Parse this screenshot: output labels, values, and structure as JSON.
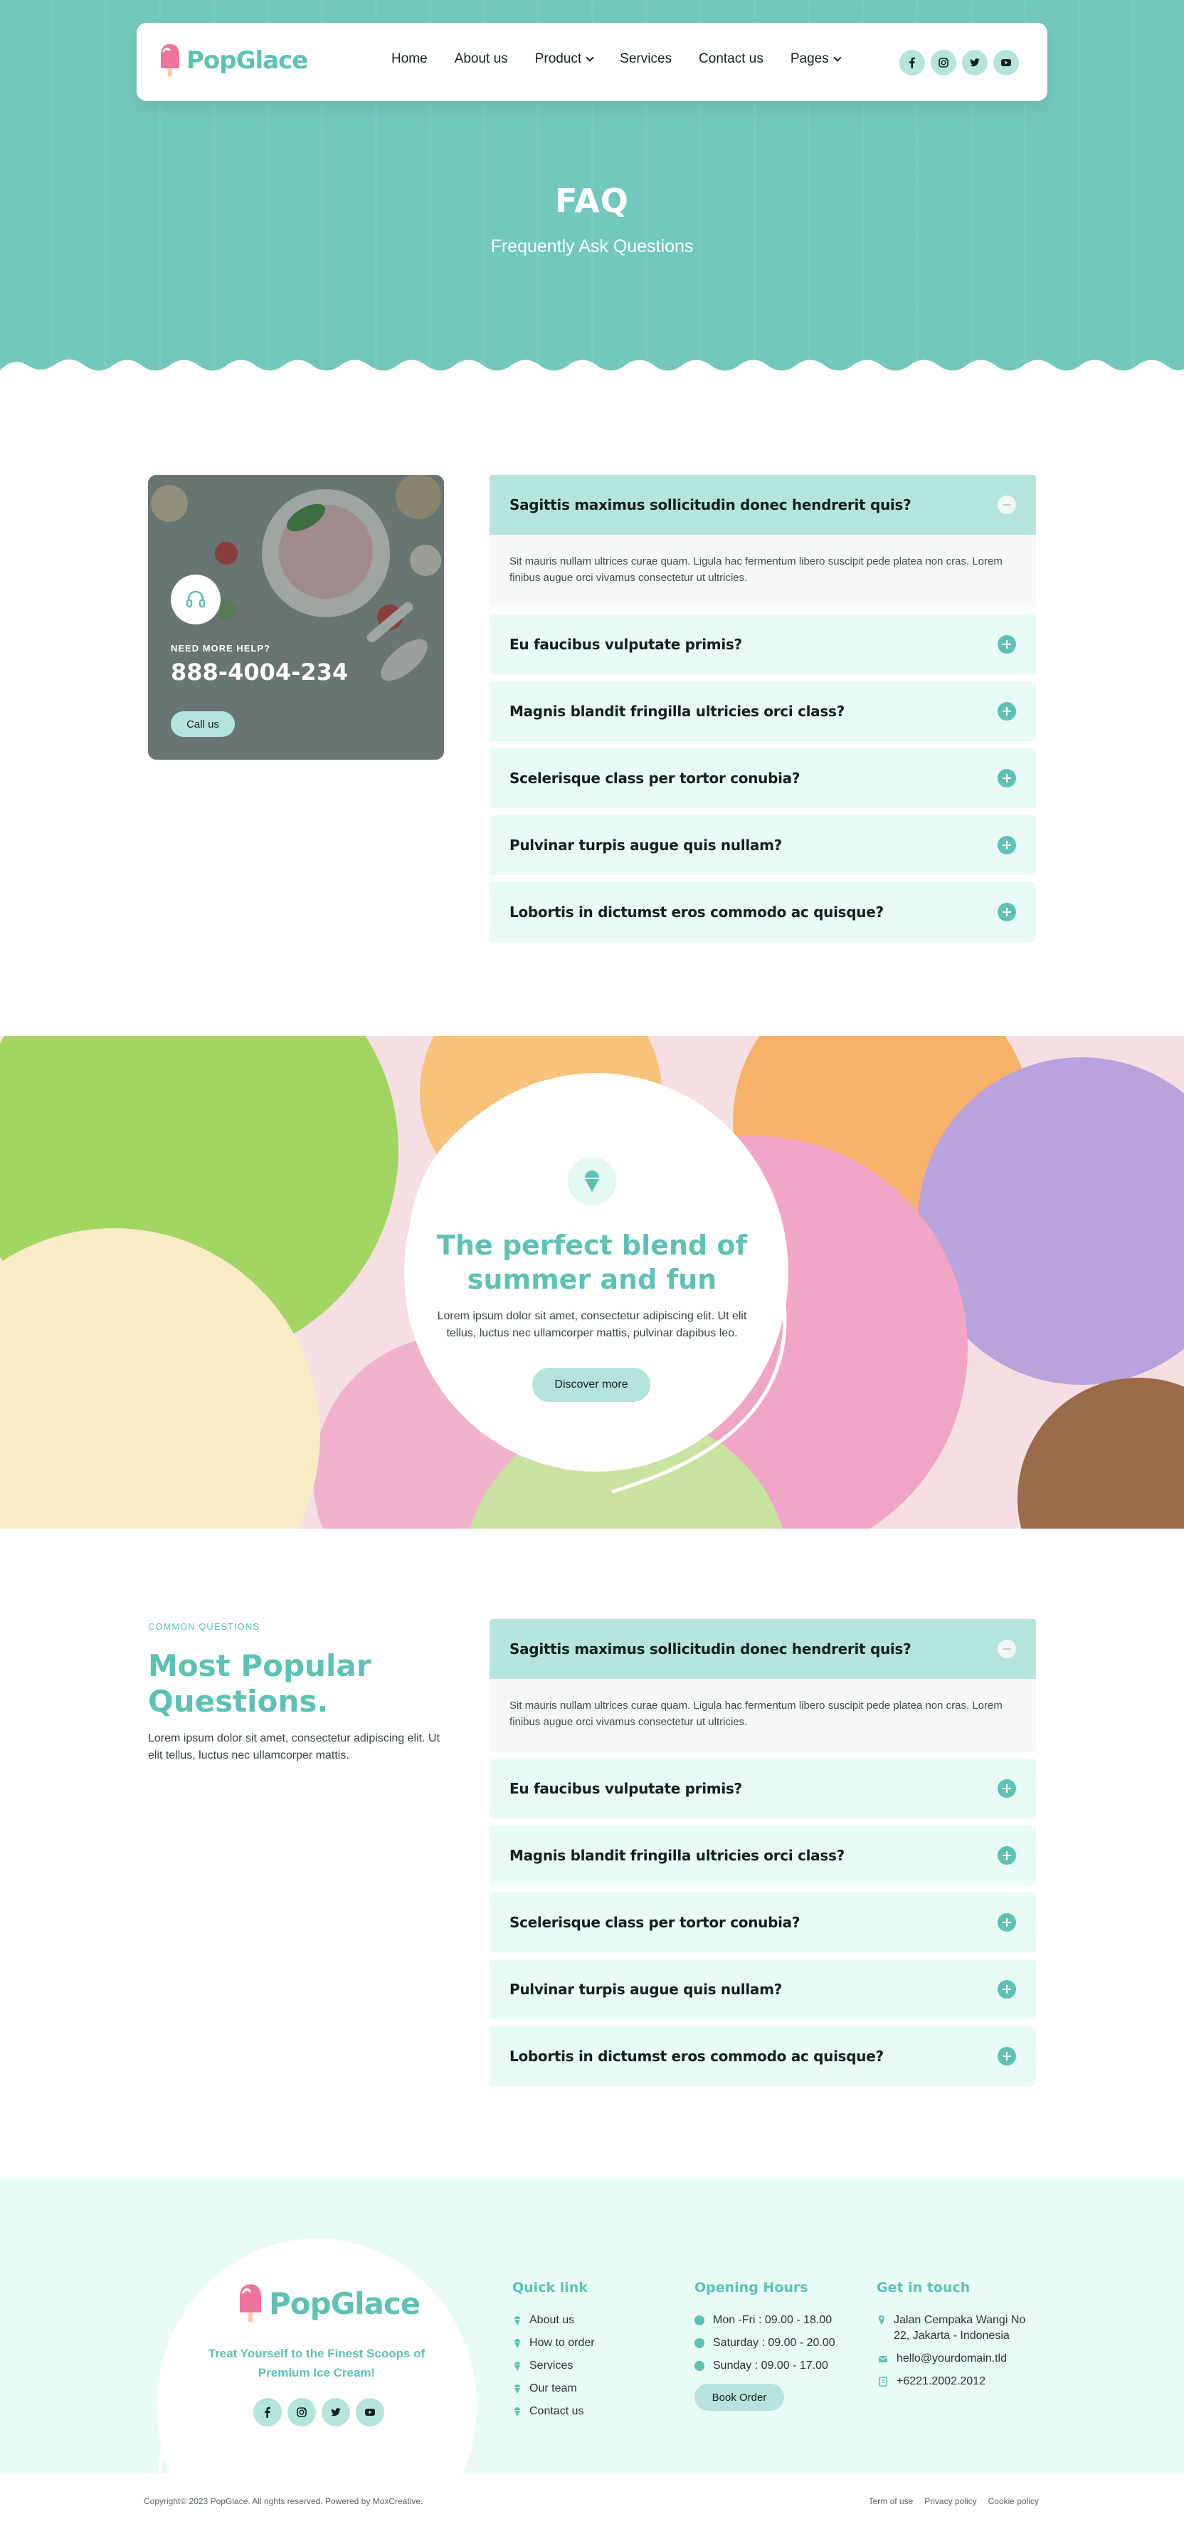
{
  "brand": {
    "name": "PopGlace"
  },
  "nav": {
    "items": [
      {
        "label": "Home"
      },
      {
        "label": "About us"
      },
      {
        "label": "Product"
      },
      {
        "label": "Services"
      },
      {
        "label": "Contact us"
      },
      {
        "label": "Pages"
      }
    ],
    "social": [
      "facebook-icon",
      "instagram-icon",
      "twitter-icon",
      "youtube-icon"
    ]
  },
  "hero": {
    "title": "FAQ",
    "subtitle": "Frequently Ask Questions"
  },
  "help": {
    "label": "NEED MORE HELP?",
    "phone": "888-4004-234",
    "button": "Call us"
  },
  "faq1": {
    "items": [
      {
        "q": "Sagittis maximus sollicitudin donec hendrerit quis?",
        "a": "Sit mauris nullam ultrices curae quam. Ligula hac fermentum libero suscipit pede platea non cras. Lorem finibus augue orci vivamus consectetur ut ultricies.",
        "open": true
      },
      {
        "q": "Eu faucibus vulputate primis?"
      },
      {
        "q": "Magnis blandit fringilla ultricies orci class?"
      },
      {
        "q": "Scelerisque class per tortor conubia?"
      },
      {
        "q": "Pulvinar turpis augue quis nullam?"
      },
      {
        "q": "Lobortis in dictumst eros commodo ac quisque?"
      }
    ]
  },
  "banner": {
    "title": "The perfect blend of summer and fun",
    "text": "Lorem ipsum dolor sit amet, consectetur adipiscing elit. Ut elit tellus, luctus nec ullamcorper mattis, pulvinar dapibus leo.",
    "button": "Discover more"
  },
  "popular": {
    "tag": "COMMON QUESTIONS",
    "title": "Most Popular Questions.",
    "text": "Lorem ipsum dolor sit amet, consectetur adipiscing elit. Ut elit tellus, luctus nec ullamcorper mattis."
  },
  "faq2": {
    "items": [
      {
        "q": "Sagittis maximus sollicitudin donec hendrerit quis?",
        "a": "Sit mauris nullam ultrices curae quam. Ligula hac fermentum libero suscipit pede platea non cras. Lorem finibus augue orci vivamus consectetur ut ultricies.",
        "open": true
      },
      {
        "q": "Eu faucibus vulputate primis?"
      },
      {
        "q": "Magnis blandit fringilla ultricies orci class?"
      },
      {
        "q": "Scelerisque class per tortor conubia?"
      },
      {
        "q": "Pulvinar turpis augue quis nullam?"
      },
      {
        "q": "Lobortis in dictumst eros commodo ac quisque?"
      }
    ]
  },
  "footer": {
    "tagline": "Treat Yourself to the Finest Scoops of Premium Ice Cream!",
    "quick": {
      "heading": "Quick link",
      "links": [
        "About us",
        "How to order",
        "Services",
        "Our team",
        "Contact us"
      ]
    },
    "hours": {
      "heading": "Opening Hours",
      "items": [
        "Mon -Fri : 09.00 - 18.00",
        "Saturday : 09.00 - 20.00",
        "Sunday : 09.00 - 17.00"
      ],
      "button": "Book Order"
    },
    "contact": {
      "heading": "Get in touch",
      "address": "Jalan Cempaka Wangi No 22, Jakarta - Indonesia",
      "email": "hello@yourdomain.tld",
      "phone": "+6221.2002.2012"
    },
    "copyright": "Copyright© 2023 PopGlace. All rights reserved. Powered by MoxCreative.",
    "legal": [
      "Term of use",
      "Privacy policy",
      "Cookie policy"
    ]
  },
  "colors": {
    "primary": "#5dc2b4",
    "hero_bg": "#73c8bc",
    "light": "#e8fbf7",
    "accent": "#b5e4dc",
    "pink": "#f0739b"
  }
}
